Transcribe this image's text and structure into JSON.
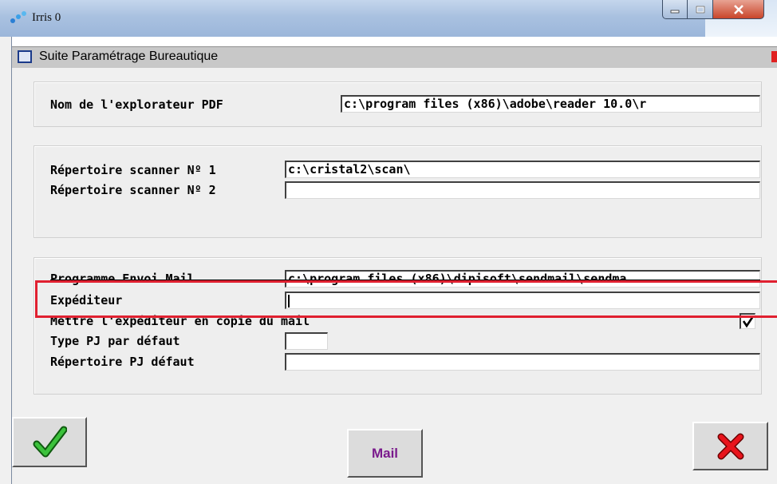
{
  "window": {
    "title": "Irris 0",
    "dialog_title": "Suite Paramétrage Bureautique"
  },
  "pdf_section": {
    "label": "Nom de l'explorateur PDF",
    "value": "c:\\program files (x86)\\adobe\\reader 10.0\\r"
  },
  "scanner_section": {
    "scanner1_label": "Répertoire scanner Nº 1",
    "scanner1_value": "c:\\cristal2\\scan\\",
    "scanner2_label": "Répertoire scanner Nº 2",
    "scanner2_value": ""
  },
  "mail_section": {
    "program_label": "Programme Envoi Mail",
    "program_value": "c:\\program files (x86)\\dipisoft\\sendmail\\sendma",
    "sender_label": "Expéditeur",
    "sender_value": "",
    "copy_label": "Mettre l'expéditeur en copie du mail",
    "copy_checked": true,
    "copy_mark": "✓",
    "attachment_type_label": "Type PJ par défaut",
    "attachment_type_value": "",
    "attachment_dir_label": "Répertoire PJ défaut",
    "attachment_dir_value": ""
  },
  "buttons": {
    "mail_label": "Mail",
    "validate_icon": "green-checkmark-icon",
    "cancel_icon": "red-x-icon"
  },
  "colors": {
    "highlight": "#e02030",
    "mail_text": "#7a1a8c",
    "check_green": "#2aa52a",
    "cancel_red": "#e8141c"
  }
}
